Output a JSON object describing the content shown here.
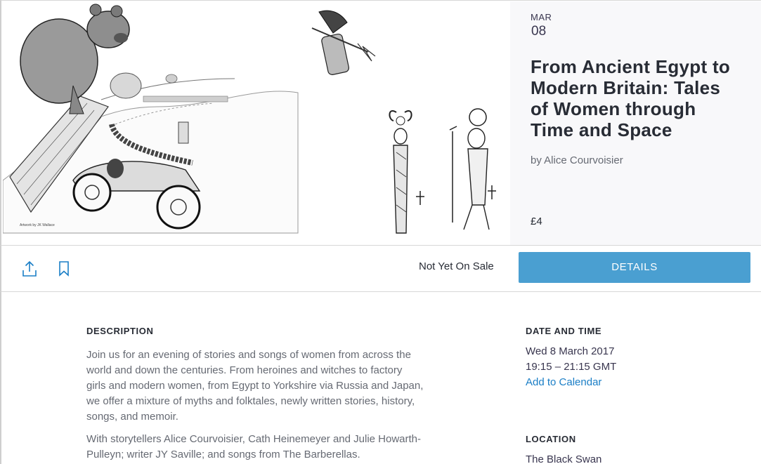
{
  "event": {
    "date_month": "MAR",
    "date_day": "08",
    "title": "From Ancient Egypt to Modern Britain: Tales of Women through Time and Space",
    "organizer": "by Alice Courvoisier",
    "price": "£4",
    "artwork_credit": "Artwork by JK Wallace"
  },
  "actions": {
    "share_icon": "share-upload-icon",
    "bookmark_icon": "bookmark-icon",
    "sale_status": "Not Yet On Sale",
    "details_label": "DETAILS"
  },
  "description": {
    "heading": "DESCRIPTION",
    "paragraphs": [
      "Join us for an evening of stories and songs of women from across the world and down the centuries. From heroines and witches to factory girls and modern women, from Egypt to Yorkshire via Russia and Japan, we offer a mixture of myths and folktales, newly written stories, history, songs, and memoir.",
      "With storytellers Alice Courvoisier, Cath Heinemeyer and Julie Howarth-Pulleyn; writer JY Saville; and songs from The Barberellas."
    ]
  },
  "date_time": {
    "heading": "DATE AND TIME",
    "date": "Wed 8 March 2017",
    "time": "19:15 – 21:15 GMT",
    "add_to_calendar": "Add to Calendar"
  },
  "location": {
    "heading": "LOCATION",
    "venue": "The Black Swan"
  },
  "colors": {
    "accent": "#4a9fd1",
    "link": "#1a7ec6",
    "panel_bg": "#f8f8fa"
  }
}
